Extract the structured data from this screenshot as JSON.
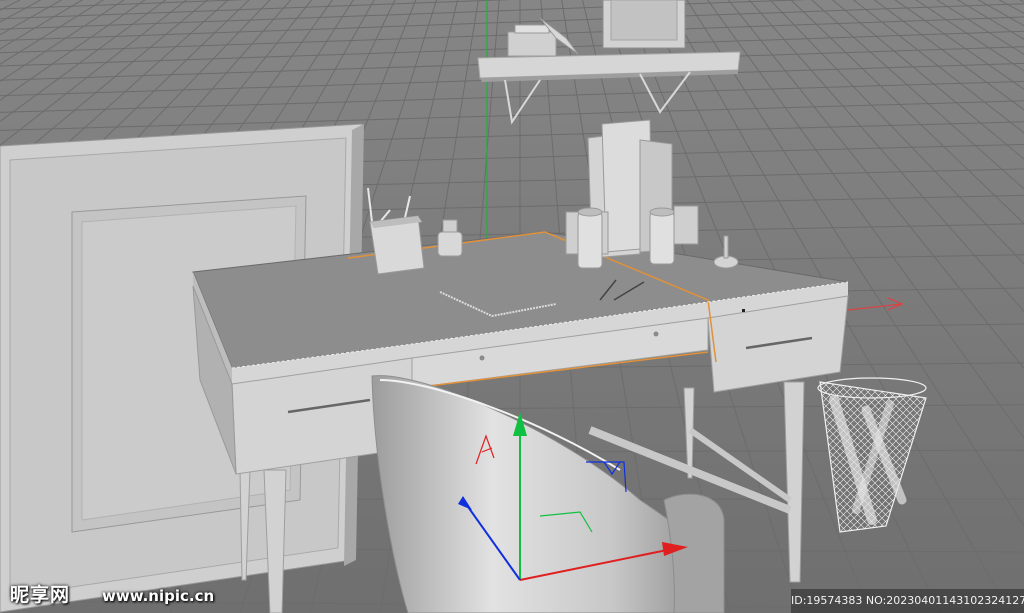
{
  "viewport": {
    "background": "#7a7a7a",
    "grid_color": "#6c6c6c",
    "model_color": "#c9c9c9",
    "selection_edge_color": "#e0913a",
    "axes": {
      "x_color": "#e02020",
      "y_color": "#10c040",
      "z_color": "#1030e0"
    }
  },
  "watermark": {
    "logo_text": "昵享网",
    "site_text": "www.nipic.cn",
    "id_text": "ID:19574383 NO:20230401143102324127"
  }
}
